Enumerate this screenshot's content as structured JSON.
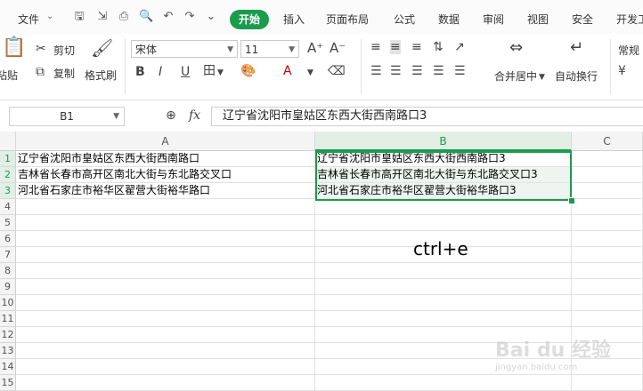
{
  "menu": {
    "file": "文件",
    "tabs": [
      "开始",
      "插入",
      "页面布局",
      "公式",
      "数据",
      "审阅",
      "视图",
      "安全",
      "开发工"
    ],
    "active_tab": "开始"
  },
  "ribbon": {
    "paste": "粘贴",
    "cut": "剪切",
    "copy": "复制",
    "format_painter": "格式刷",
    "font_name": "宋体",
    "font_size": "11",
    "merge_center": "合并居中",
    "wrap_text": "自动换行",
    "number_format": "常规",
    "bold": "B",
    "italic": "I",
    "underline": "U",
    "grow_font": "A⁺",
    "shrink_font": "A⁻"
  },
  "formula_bar": {
    "name_box": "B1",
    "fx": "fx",
    "value": "辽宁省沈阳市皇姑区东西大街西南路口3"
  },
  "sheet": {
    "columns": [
      "A",
      "B",
      "C"
    ],
    "rows": [
      "1",
      "2",
      "3",
      "4",
      "5",
      "6",
      "7",
      "8",
      "9",
      "10",
      "11",
      "12",
      "13",
      "14",
      "15"
    ],
    "col_a": [
      "辽宁省沈阳市皇姑区东西大街西南路口",
      "吉林省长春市高开区南北大街与东北路交叉口",
      "河北省石家庄市裕华区翟营大街裕华路口"
    ],
    "col_b": [
      "辽宁省沈阳市皇姑区东西大街西南路口3",
      "吉林省长春市高开区南北大街与东北路交叉口3",
      "河北省石家庄市裕华区翟营大街裕华路口3"
    ],
    "selected_column": "B",
    "selected_rows": [
      "1",
      "2",
      "3"
    ]
  },
  "annotation": "ctrl+e",
  "watermark": {
    "main": "Bai du 经验",
    "sub": "jingyan.baidu.com"
  },
  "colors": {
    "accent": "#1a9c4d",
    "selection_fill": "#eef4f0"
  }
}
